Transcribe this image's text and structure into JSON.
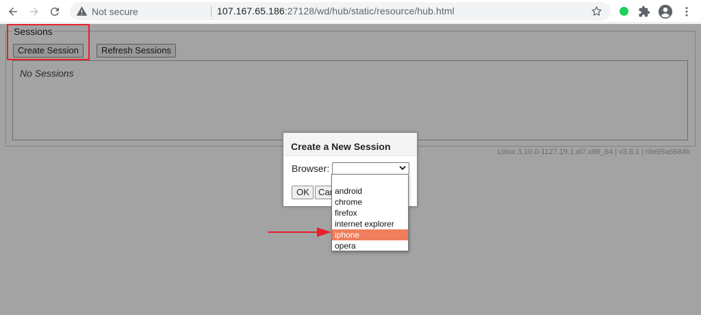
{
  "browser": {
    "security_label": "Not secure",
    "url_host": "107.167.65.186",
    "url_rest": ":27128/wd/hub/static/resource/hub.html"
  },
  "page": {
    "legend": "Sessions",
    "create_session_label": "Create Session",
    "refresh_sessions_label": "Refresh Sessions",
    "no_sessions_text": "No Sessions",
    "footer_info": "Linux 3.10.0-1127.19.1.el7.x86_64  |  v3.8.1  |  r6e95a6684b"
  },
  "dialog": {
    "title": "Create a New Session",
    "browser_label": "Browser:",
    "browser_value": "",
    "ok_label": "OK",
    "cancel_label": "Cancel",
    "options": [
      "",
      "android",
      "chrome",
      "firefox",
      "internet explorer",
      "iphone",
      "opera"
    ],
    "highlighted_option": "iphone"
  },
  "colors": {
    "annotation_red": "#e8202a",
    "option_highlight": "#f07d5b",
    "extension_green": "#1ad15b"
  },
  "icons": [
    "back-icon",
    "forward-icon",
    "reload-icon",
    "warning-icon",
    "star-icon",
    "extension-icon",
    "puzzle-icon",
    "profile-icon",
    "menu-icon"
  ]
}
